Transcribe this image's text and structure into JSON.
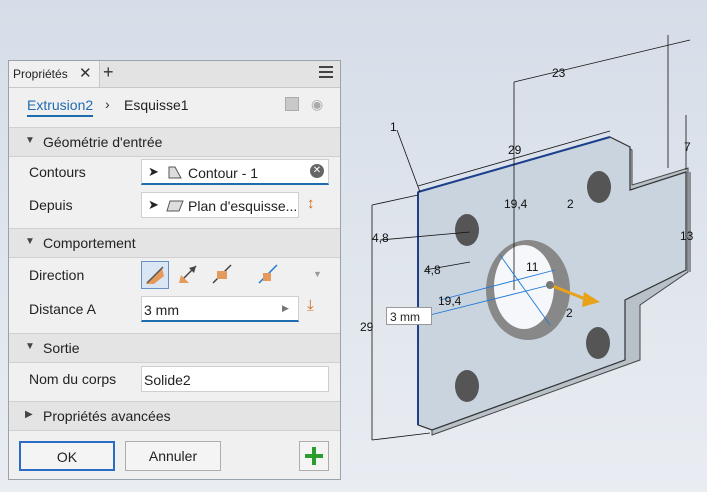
{
  "tab": {
    "label": "Propriétés"
  },
  "breadcrumb": {
    "feature": "Extrusion2",
    "sketch": "Esquisse1"
  },
  "sections": {
    "input_geometry": "Géométrie d'entrée",
    "behavior": "Comportement",
    "output": "Sortie",
    "advanced": "Propriétés avancées"
  },
  "fields": {
    "contours_label": "Contours",
    "contours_value": "Contour - 1",
    "depuis_label": "Depuis",
    "depuis_value": "Plan d'esquisse...",
    "direction_label": "Direction",
    "distance_label": "Distance A",
    "distance_value": "3 mm",
    "body_label": "Nom du corps",
    "body_value": "Solide2"
  },
  "buttons": {
    "ok": "OK",
    "cancel": "Annuler"
  },
  "viewport": {
    "dims": {
      "d1": "1",
      "d23": "23",
      "d29top": "29",
      "d7": "7",
      "d194a": "19,4",
      "d2a": "2",
      "d48a": "4,8",
      "d13": "13",
      "d48b": "4,8",
      "d11": "11",
      "d194b": "19,4",
      "d29left": "29",
      "d2b": "2"
    },
    "inline_input": "3 mm"
  },
  "colors": {
    "accent": "#1f6bb0",
    "arrow": "#e8a21a",
    "part_face": "#c9d4df"
  }
}
